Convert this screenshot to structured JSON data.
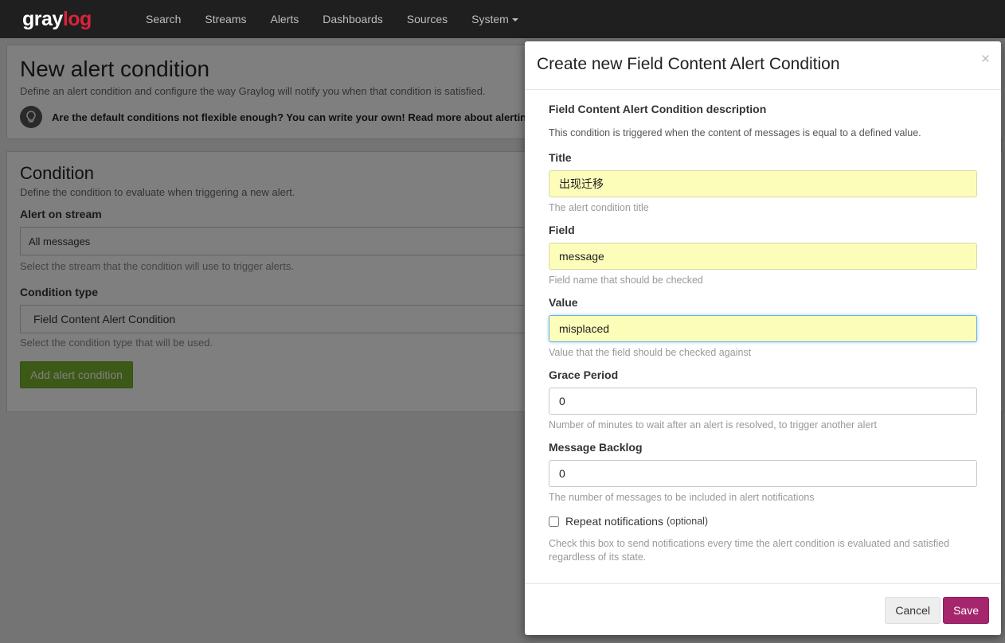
{
  "navbar": {
    "brand_part1": "gray",
    "brand_part2": "log",
    "items": [
      "Search",
      "Streams",
      "Alerts",
      "Dashboards",
      "Sources",
      "System"
    ]
  },
  "page": {
    "title": "New alert condition",
    "subtitle": "Define an alert condition and configure the way Graylog will notify you when that condition is satisfied.",
    "tip": "Are the default conditions not flexible enough? You can write your own! Read more about alerting in",
    "condition": {
      "title": "Condition",
      "subtitle": "Define the condition to evaluate when triggering a new alert.",
      "stream_label": "Alert on stream",
      "stream_value": "All messages",
      "stream_help": "Select the stream that the condition will use to trigger alerts.",
      "type_label": "Condition type",
      "type_value": "Field Content Alert Condition",
      "type_help": "Select the condition type that will be used.",
      "add_button": "Add alert condition"
    }
  },
  "modal": {
    "title": "Create new Field Content Alert Condition",
    "close": "×",
    "section_title": "Field Content Alert Condition description",
    "description": "This condition is triggered when the content of messages is equal to a defined value.",
    "fields": {
      "title": {
        "label": "Title",
        "value": "出现迁移",
        "help": "The alert condition title"
      },
      "field": {
        "label": "Field",
        "value": "message",
        "help": "Field name that should be checked"
      },
      "value": {
        "label": "Value",
        "value": "misplaced",
        "help": "Value that the field should be checked against"
      },
      "grace": {
        "label": "Grace Period",
        "value": "0",
        "help": "Number of minutes to wait after an alert is resolved, to trigger another alert"
      },
      "backlog": {
        "label": "Message Backlog",
        "value": "0",
        "help": "The number of messages to be included in alert notifications"
      }
    },
    "repeat": {
      "label": "Repeat notifications",
      "optional": "(optional)",
      "help": "Check this box to send notifications every time the alert condition is evaluated and satisfied regardless of its state."
    },
    "cancel": "Cancel",
    "save": "Save"
  },
  "colors": {
    "navbar": "#1f1f1f",
    "brand_accent": "#d6243b",
    "primary": "#a6266e",
    "success": "#7bb32e",
    "autofill": "#fdfdba"
  }
}
